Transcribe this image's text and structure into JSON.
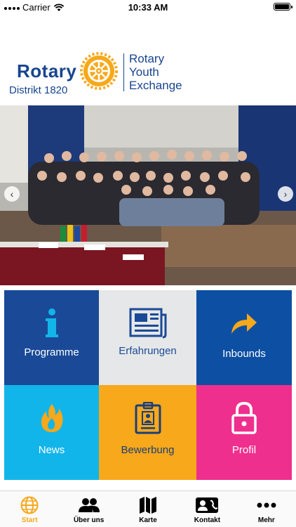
{
  "status_bar": {
    "carrier": "Carrier",
    "time": "10:33 AM"
  },
  "logo": {
    "rotary": "Rotary",
    "district": "Distrikt 1820",
    "program_line1": "Rotary",
    "program_line2": "Youth",
    "program_line3": "Exchange"
  },
  "colors": {
    "brand_blue": "#17458f",
    "gold": "#f7a81b",
    "cyan": "#12b5e9",
    "pink": "#ef2f8d",
    "grey": "#e6e7e8"
  },
  "tiles": [
    {
      "label": "Programme",
      "icon": "info-icon"
    },
    {
      "label": "Erfahrungen",
      "icon": "newspaper-icon"
    },
    {
      "label": "Inbounds",
      "icon": "share-arrow-icon"
    },
    {
      "label": "News",
      "icon": "flame-icon"
    },
    {
      "label": "Bewerbung",
      "icon": "id-badge-icon"
    },
    {
      "label": "Profil",
      "icon": "lock-icon"
    }
  ],
  "tabbar": [
    {
      "label": "Start",
      "icon": "globe-icon",
      "active": true
    },
    {
      "label": "Über uns",
      "icon": "people-icon",
      "active": false
    },
    {
      "label": "Karte",
      "icon": "map-icon",
      "active": false
    },
    {
      "label": "Kontakt",
      "icon": "contact-card-icon",
      "active": false
    },
    {
      "label": "Mehr",
      "icon": "more-dots-icon",
      "active": false
    }
  ]
}
